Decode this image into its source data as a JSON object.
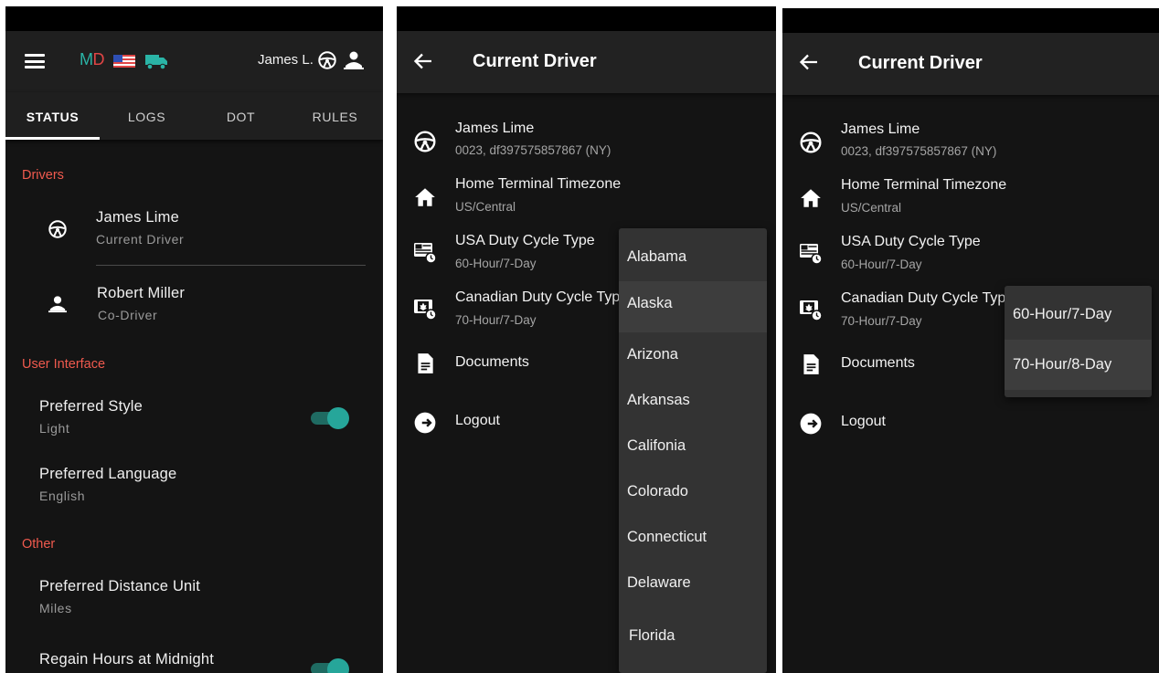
{
  "status_screen": {
    "header": {
      "logo_m": "M",
      "logo_d": "D",
      "user_short": "James L."
    },
    "tabs": [
      {
        "label": "STATUS",
        "active": true
      },
      {
        "label": "LOGS",
        "active": false
      },
      {
        "label": "DOT",
        "active": false
      },
      {
        "label": "RULES",
        "active": false
      }
    ],
    "sections": {
      "drivers": "Drivers",
      "user_interface": "User Interface",
      "other": "Other"
    },
    "drivers": [
      {
        "name": "James Lime",
        "role": "Current Driver",
        "icon": "steering-wheel-icon"
      },
      {
        "name": "Robert Miller",
        "role": "Co-Driver",
        "icon": "person-icon"
      }
    ],
    "settings": {
      "preferred_style": {
        "title": "Preferred Style",
        "value": "Light",
        "toggle_on": true
      },
      "preferred_language": {
        "title": "Preferred Language",
        "value": "English"
      },
      "preferred_distance_unit": {
        "title": "Preferred Distance Unit",
        "value": "Miles"
      },
      "regain_hours": {
        "title": "Regain Hours at Midnight",
        "toggle_on": true
      }
    }
  },
  "current_driver_screen": {
    "title": "Current Driver",
    "items": [
      {
        "title": "James Lime",
        "sub": "0023, df397575857867 (NY)",
        "icon": "steering-wheel-icon"
      },
      {
        "title": "Home Terminal Timezone",
        "sub": "US/Central",
        "icon": "home-icon"
      },
      {
        "title": "USA Duty Cycle Type",
        "sub": "60-Hour/7-Day",
        "icon": "usa-flag-clock-icon"
      },
      {
        "title": "Canadian Duty Cycle Type",
        "sub": "70-Hour/7-Day",
        "icon": "canada-flag-clock-icon"
      },
      {
        "title": "Documents",
        "sub": "",
        "icon": "document-icon"
      },
      {
        "title": "Logout",
        "sub": "",
        "icon": "logout-icon"
      }
    ]
  },
  "states_dropdown": {
    "options": [
      "Alabama",
      "Alaska",
      "Arizona",
      "Arkansas",
      "Califonia",
      "Colorado",
      "Connecticut",
      "Delaware",
      "Florida"
    ],
    "highlighted": "Alaska"
  },
  "cycle_dropdown": {
    "options": [
      "60-Hour/7-Day",
      "70-Hour/8-Day"
    ],
    "highlighted": "70-Hour/8-Day"
  },
  "colors": {
    "background": "#141414",
    "app_bar": "#1f1f1f",
    "accent_red": "#f05a4e",
    "toggle_teal": "#26a69a",
    "logo_teal": "#2ab4a6",
    "dropdown": "#333333"
  }
}
